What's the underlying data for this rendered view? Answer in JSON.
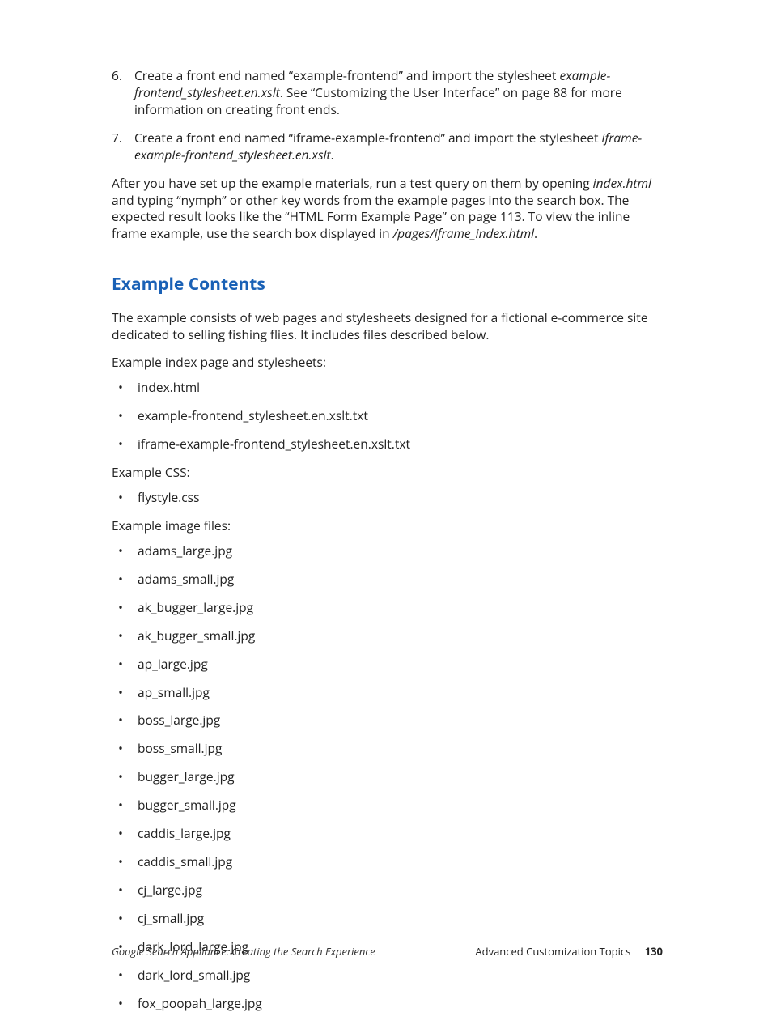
{
  "orderedSteps": [
    {
      "num": "6.",
      "segments": [
        {
          "t": "Create a front end named “example-frontend” and import the stylesheet "
        },
        {
          "t": "example-frontend_stylesheet.en.xslt",
          "italic": true
        },
        {
          "t": ". See “Customizing the User Interface” on page 88 for more information on creating front ends."
        }
      ]
    },
    {
      "num": "7.",
      "segments": [
        {
          "t": "Create a front end named “iframe-example-frontend” and import the stylesheet "
        },
        {
          "t": "iframe-example-frontend_stylesheet.en.xslt",
          "italic": true
        },
        {
          "t": "."
        }
      ]
    }
  ],
  "afterPara": {
    "segments": [
      {
        "t": "After you have set up the example materials, run a test query on them by opening "
      },
      {
        "t": "index.html",
        "italic": true
      },
      {
        "t": " and typing “nymph” or other key words from the example pages into the search box. The expected result looks like the “HTML Form Example Page” on page 113. To view the inline frame example, use the search box displayed in "
      },
      {
        "t": "/pages/iframe_index.html",
        "italic": true
      },
      {
        "t": "."
      }
    ]
  },
  "sectionHeading": "Example Contents",
  "sectionIntro": "The example consists of web pages and stylesheets designed for a fictional e-commerce site dedicated to selling fishing flies. It includes files described below.",
  "groups": [
    {
      "label": "Example index page and stylesheets:",
      "items": [
        "index.html",
        "example-frontend_stylesheet.en.xslt.txt",
        "iframe-example-frontend_stylesheet.en.xslt.txt"
      ]
    },
    {
      "label": "Example CSS:",
      "items": [
        "flystyle.css"
      ]
    },
    {
      "label": "Example image files:",
      "items": [
        "adams_large.jpg",
        "adams_small.jpg",
        "ak_bugger_large.jpg",
        "ak_bugger_small.jpg",
        "ap_large.jpg",
        "ap_small.jpg",
        "boss_large.jpg",
        "boss_small.jpg",
        "bugger_large.jpg",
        "bugger_small.jpg",
        "caddis_large.jpg",
        "caddis_small.jpg",
        "cj_large.jpg",
        "cj_small.jpg",
        "dark_lord_large.jpg",
        "dark_lord_small.jpg",
        "fox_poopah_large.jpg"
      ]
    }
  ],
  "footer": {
    "left": "Google Search Appliance: Creating the Search Experience",
    "rightLabel": "Advanced Customization Topics",
    "pageNum": "130"
  }
}
